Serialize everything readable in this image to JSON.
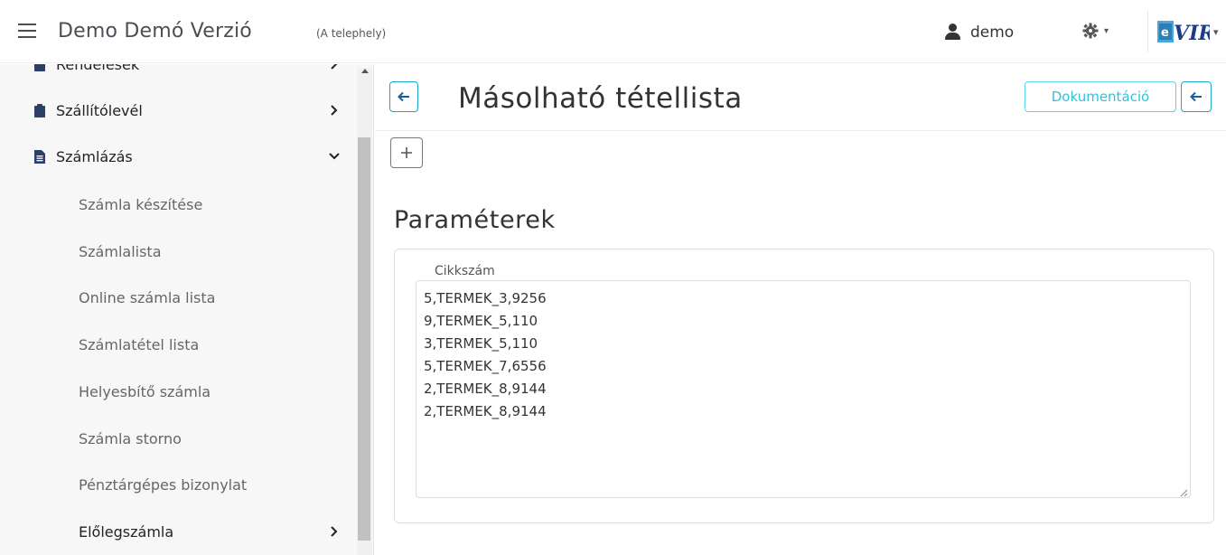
{
  "app": {
    "title": "Demo Demó Verzió",
    "site_label": "(A telephely)",
    "user_name": "demo",
    "logo_text": "eVIR"
  },
  "sidebar": {
    "items_top": [
      {
        "label": "Rendelések",
        "icon": "clipboard-icon",
        "expanded": false
      },
      {
        "label": "Szállítólevél",
        "icon": "clipboard-icon",
        "expanded": false
      },
      {
        "label": "Számlázás",
        "icon": "document-icon",
        "expanded": true
      }
    ],
    "subitems": [
      {
        "label": "Számla készítése"
      },
      {
        "label": "Számlalista"
      },
      {
        "label": "Online számla lista"
      },
      {
        "label": "Számlatétel lista"
      },
      {
        "label": "Helyesbítő számla"
      },
      {
        "label": "Számla storno"
      },
      {
        "label": "Pénztárgépes bizonylat"
      },
      {
        "label": "Előlegszámla"
      }
    ]
  },
  "page": {
    "title": "Másolható tétellista",
    "doc_button": "Dokumentáció",
    "section_title": "Paraméterek",
    "field": {
      "legend": "Cikkszám",
      "value": "5,TERMEK_3,9256\n9,TERMEK_5,110\n3,TERMEK_5,110\n5,TERMEK_7,6556\n2,TERMEK_8,9144\n2,TERMEK_8,9144"
    }
  },
  "colors": {
    "accent": "#1aa6c9",
    "doc_accent": "#33c1dd",
    "sidebar_bg": "#f7f7f7"
  }
}
